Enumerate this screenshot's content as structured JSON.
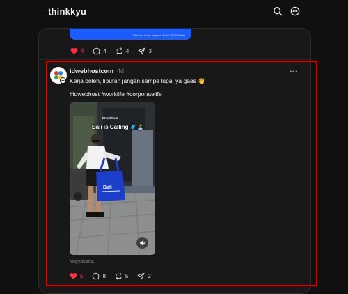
{
  "app": {
    "brand": "thinkkyu"
  },
  "icons": {
    "search": "search-icon",
    "options": "more-options-icon"
  },
  "previous_post": {
    "image_caption": "* Berlaku untuk segmen SaaS ISP Oktober",
    "likes": "4",
    "replies": "4",
    "reposts": "4",
    "shares": "3"
  },
  "post": {
    "username": "idwebhostcom",
    "time": "4d",
    "caption": "Kerja boleh, liburan jangan sampe lupa, ya gaes 👋",
    "hashtags": "#idwebhost #worklife #corporatelife",
    "media": {
      "logo": "IDwebhost",
      "title": "Bali is Calling 🧳🏝️"
    },
    "location": "Yogyakarta",
    "likes": "5",
    "replies": "8",
    "reposts": "5",
    "shares": "2"
  },
  "colors": {
    "like": "#ff3040",
    "accent_blue": "#1a5cff",
    "highlight": "#e00000"
  }
}
